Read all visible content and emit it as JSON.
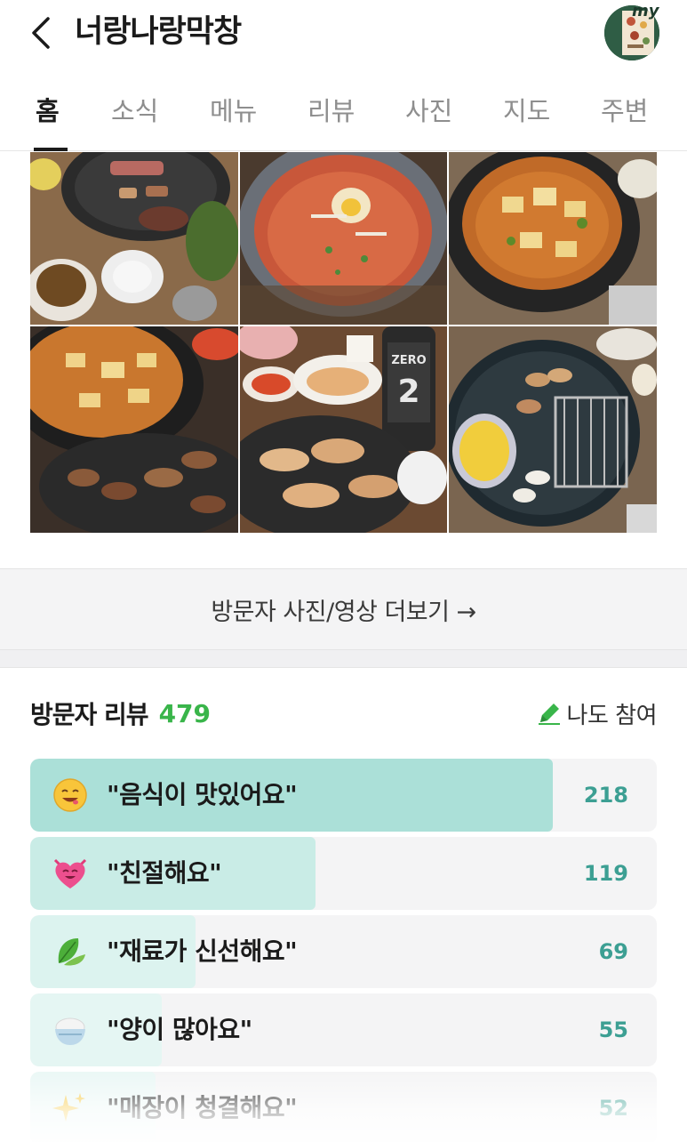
{
  "header": {
    "title": "너랑나랑막창",
    "back_icon": "chevron-left-icon",
    "profile_badge": "my"
  },
  "tabs": [
    {
      "label": "홈",
      "active": true
    },
    {
      "label": "소식",
      "active": false
    },
    {
      "label": "메뉴",
      "active": false
    },
    {
      "label": "리뷰",
      "active": false
    },
    {
      "label": "사진",
      "active": false
    },
    {
      "label": "지도",
      "active": false
    },
    {
      "label": "주변",
      "active": false
    }
  ],
  "photos": [
    {
      "name": "grilled-meat-on-grill-photo"
    },
    {
      "name": "cold-noodle-soup-photo"
    },
    {
      "name": "doenjang-stew-photo"
    },
    {
      "name": "stew-and-grilled-meat-photo"
    },
    {
      "name": "grilled-meat-and-soju-photo"
    },
    {
      "name": "grill-with-corn-cheese-photo"
    }
  ],
  "soju_label": {
    "brand": "ZERO",
    "number": "2"
  },
  "more_photos": {
    "label": "방문자 사진/영상 더보기 →"
  },
  "reviews": {
    "title": "방문자 리뷰",
    "count": "479",
    "join_label": "나도 참여",
    "join_icon": "pencil-icon",
    "accent_color": "#39b54a",
    "items": [
      {
        "emoji": "smiling-face-icon",
        "label": "\"음식이 맛있어요\"",
        "value": "218",
        "fraction": 1.0,
        "fill": "#abe0d8"
      },
      {
        "emoji": "heart-face-icon",
        "label": "\"친절해요\"",
        "value": "119",
        "fraction": 0.546,
        "fill": "#c9ece6"
      },
      {
        "emoji": "leaf-icon",
        "label": "\"재료가 신선해요\"",
        "value": "69",
        "fraction": 0.317,
        "fill": "#dcf3ef"
      },
      {
        "emoji": "rice-bowl-icon",
        "label": "\"양이 많아요\"",
        "value": "55",
        "fraction": 0.252,
        "fill": "#e5f6f3"
      },
      {
        "emoji": "sparkles-icon",
        "label": "\"매장이 청결해요\"",
        "value": "52",
        "fraction": 0.239,
        "fill": "#e9f7f5"
      }
    ]
  }
}
